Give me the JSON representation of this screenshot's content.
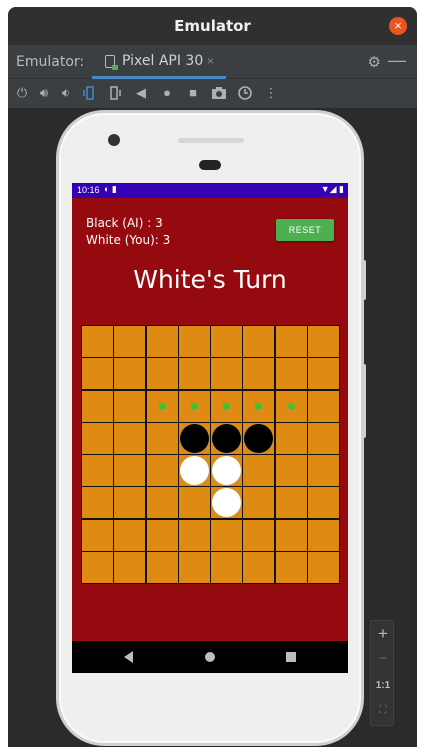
{
  "window": {
    "title": "Emulator"
  },
  "tabs": {
    "label": "Emulator:",
    "device_tab": "Pixel API 30",
    "close_glyph": "×"
  },
  "phone": {
    "status_time": "10:16",
    "score_black": "Black (AI) : 3",
    "score_white": "White (You): 3",
    "reset_label": "RESET",
    "turn_text": "White's Turn"
  },
  "board": {
    "size": 8,
    "colors": {
      "cell": "#df8a12",
      "background": "#940a0e",
      "hint": "#3cc23c"
    },
    "discs": [
      {
        "row": 3,
        "col": 3,
        "color": "black"
      },
      {
        "row": 3,
        "col": 4,
        "color": "black"
      },
      {
        "row": 3,
        "col": 5,
        "color": "black"
      },
      {
        "row": 4,
        "col": 3,
        "color": "white"
      },
      {
        "row": 4,
        "col": 4,
        "color": "white"
      },
      {
        "row": 5,
        "col": 4,
        "color": "white"
      }
    ],
    "hints": [
      {
        "row": 2,
        "col": 2
      },
      {
        "row": 2,
        "col": 3
      },
      {
        "row": 2,
        "col": 4
      },
      {
        "row": 2,
        "col": 5
      },
      {
        "row": 2,
        "col": 6
      }
    ]
  },
  "zoom": {
    "plus": "+",
    "minus": "−",
    "ratio": "1:1"
  }
}
